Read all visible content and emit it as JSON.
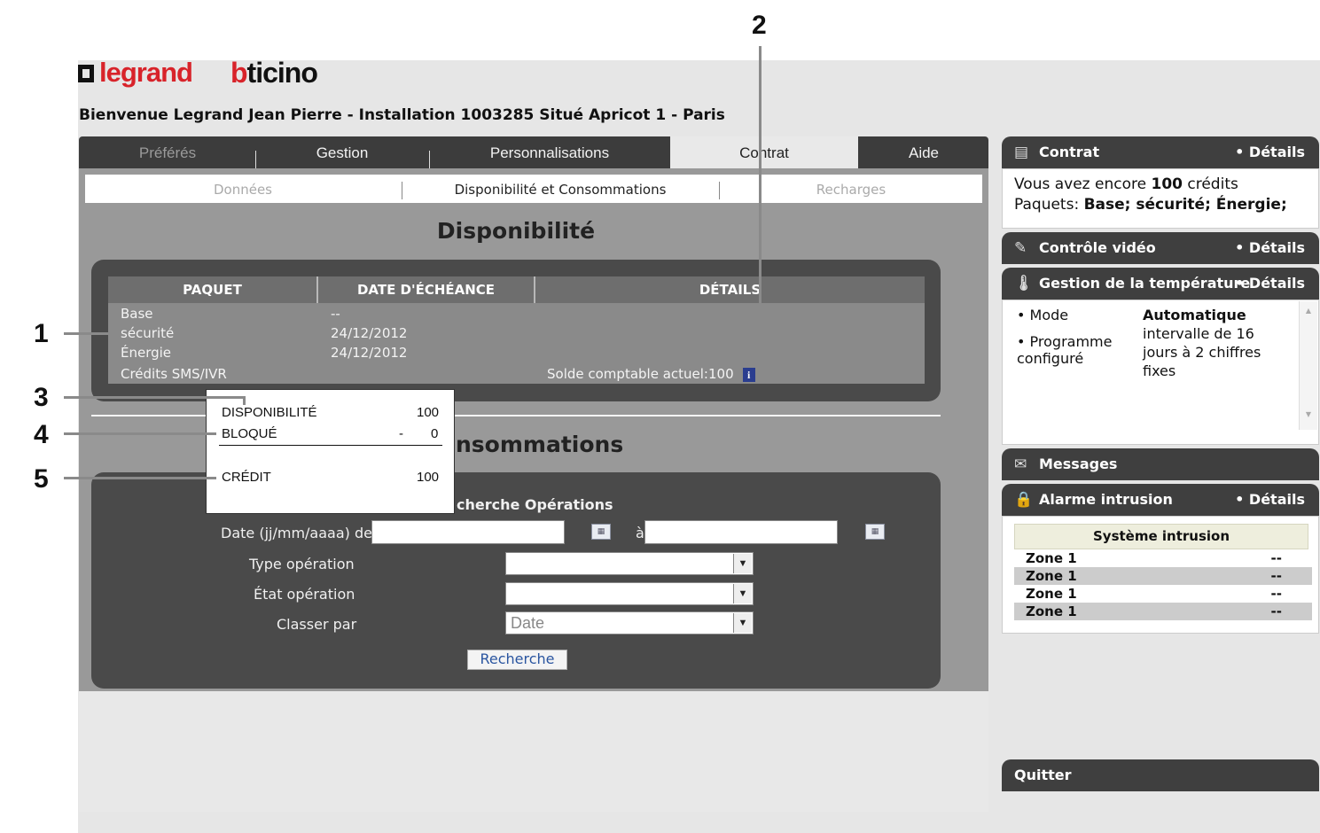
{
  "branding": {
    "logo1": "legrand",
    "logo2_prefix": "b",
    "logo2_rest": "ticino"
  },
  "welcome": "Bienvenue Legrand Jean Pierre - Installation 1003285 Situé Apricot 1 - Paris",
  "main_tabs": [
    "Préférés",
    "Gestion",
    "Personnalisations",
    "Contrat",
    "Aide"
  ],
  "sub_tabs": [
    "Données",
    "Disponibilité et Consommations",
    "Recharges"
  ],
  "availability": {
    "title": "Disponibilité",
    "headers": [
      "PAQUET",
      "DATE D'ÉCHÉANCE",
      "DÉTAILS"
    ],
    "rows": [
      {
        "package": "Base",
        "date": "--"
      },
      {
        "package": "sécurité",
        "date": "24/12/2012"
      },
      {
        "package": "Énergie",
        "date": "24/12/2012"
      }
    ],
    "sms_label": "Crédits SMS/IVR",
    "balance": "Solde comptable actuel:100",
    "info_icon": "i"
  },
  "consumptions": {
    "title_visible": "nsommations",
    "search_title_visible": "cherche Opérations",
    "date_label": "Date (jj/mm/aaaa) de",
    "date_to": "à",
    "type_label": "Type opération",
    "state_label": "État opération",
    "sort_label": "Classer par",
    "sort_value": "Date",
    "search_button": "Recherche"
  },
  "popup": {
    "rows": [
      {
        "label": "DISPONIBILITÉ",
        "sign": "",
        "value": "100"
      },
      {
        "label": "BLOQUÉ",
        "sign": "-",
        "value": "0"
      },
      {
        "label": "CRÉDIT",
        "sign": "",
        "value": "100"
      }
    ]
  },
  "callouts": [
    "1",
    "2",
    "3",
    "4",
    "5"
  ],
  "sidebar": {
    "contract": {
      "title": "Contrat",
      "details": "• Détails",
      "icon": "document-icon",
      "line1_a": "Vous avez encore ",
      "line1_b": "100",
      "line1_c": " crédits",
      "line2_a": "Paquets: ",
      "line2_b": "Base; sécurité; Énergie;"
    },
    "video": {
      "title": "Contrôle vidéo",
      "details": "• Détails",
      "icon": "camera-icon"
    },
    "temperature": {
      "title": "Gestion de la température",
      "details": "• Détails",
      "icon": "thermometer-icon",
      "mode_label": "• Mode",
      "mode_value": "Automatique",
      "prog_label1": "• Programme",
      "prog_label2": "configuré",
      "prog_value1": "intervalle de 16",
      "prog_value2": "jours à 2 chiffres",
      "prog_value3": "fixes"
    },
    "messages": {
      "title": "Messages",
      "icon": "envelope-icon"
    },
    "alarm": {
      "title": "Alarme intrusion",
      "details": "• Détails",
      "icon": "lock-icon",
      "system": "Système intrusion",
      "zones": [
        {
          "name": "Zone 1",
          "value": "--"
        },
        {
          "name": "Zone 1",
          "value": "--"
        },
        {
          "name": "Zone 1",
          "value": "--"
        },
        {
          "name": "Zone 1",
          "value": "--"
        }
      ]
    },
    "quit": "Quitter"
  }
}
